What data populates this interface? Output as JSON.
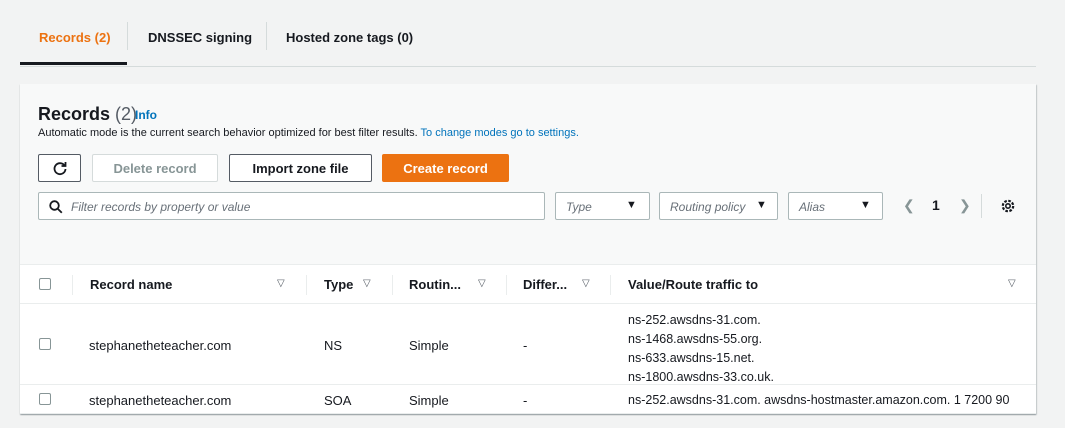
{
  "tabs": [
    {
      "label": "Records (2)",
      "active": true
    },
    {
      "label": "DNSSEC signing",
      "active": false
    },
    {
      "label": "Hosted zone tags (0)",
      "active": false
    }
  ],
  "panel": {
    "title": "Records",
    "count": "(2)",
    "info": "Info",
    "description": "Automatic mode is the current search behavior optimized for best filter results.",
    "description_link": "To change modes go to settings.",
    "buttons": {
      "refresh_icon": "refresh-icon",
      "delete": "Delete record",
      "import": "Import zone file",
      "create": "Create record"
    },
    "search_placeholder": "Filter records by property or value",
    "filters": {
      "type": "Type",
      "routing": "Routing policy",
      "alias": "Alias"
    },
    "page": "1"
  },
  "table": {
    "columns": [
      "Record name",
      "Type",
      "Routin...",
      "Differ...",
      "Value/Route traffic to"
    ],
    "rows": [
      {
        "name": "stephanetheteacher.com",
        "type": "NS",
        "routing": "Simple",
        "differ": "-",
        "values": [
          "ns-252.awsdns-31.com.",
          "ns-1468.awsdns-55.org.",
          "ns-633.awsdns-15.net.",
          "ns-1800.awsdns-33.co.uk."
        ]
      },
      {
        "name": "stephanetheteacher.com",
        "type": "SOA",
        "routing": "Simple",
        "differ": "-",
        "values": [
          "ns-252.awsdns-31.com. awsdns-hostmaster.amazon.com. 1 7200 90"
        ]
      }
    ]
  },
  "colors": {
    "accent": "#ec7211",
    "link": "#0073bb"
  }
}
